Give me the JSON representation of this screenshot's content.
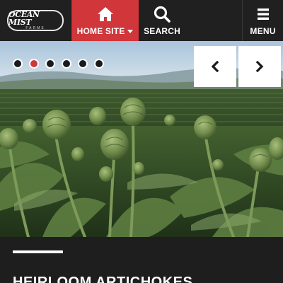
{
  "header": {
    "logo_text": "OCEAN MIST",
    "logo_subtext": "FARMS",
    "nav": {
      "home_label": "HOME SITE",
      "search_label": "SEARCH",
      "menu_label": "MENU"
    }
  },
  "hero": {
    "slide_count": 6,
    "active_slide": 2,
    "image": "artichoke-field-photo"
  },
  "content": {
    "title": "HEIRLOOM ARTICHOKES"
  },
  "colors": {
    "accent": "#d0363a",
    "header_bg": "#202020",
    "content_bg": "#1e1e1e"
  },
  "icons": {
    "home": "home-icon",
    "search": "search-icon",
    "menu": "hamburger-menu-icon",
    "prev": "chevron-left-icon",
    "next": "chevron-right-icon"
  }
}
